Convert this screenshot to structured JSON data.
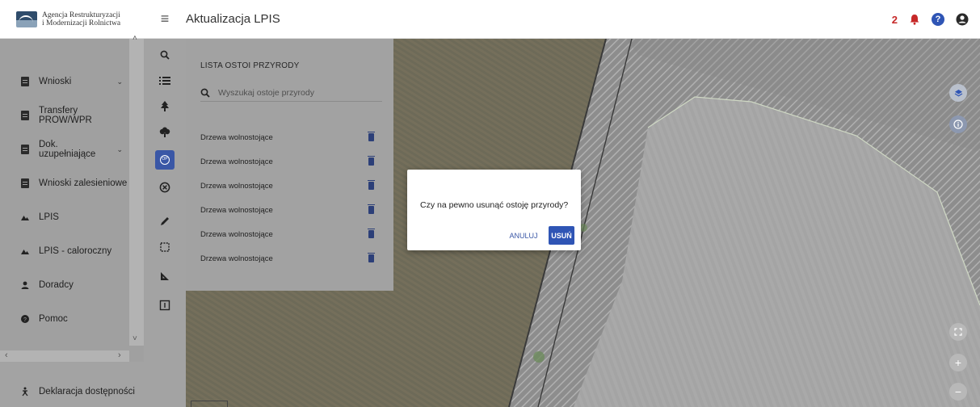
{
  "header": {
    "brand_line1": "Agencja Restrukturyzacji",
    "brand_line2": "i Modernizacji Rolnictwa",
    "menu_icon": "hamburger-icon",
    "title": "Aktualizacja LPIS",
    "notification_count": "2",
    "icons": [
      "bell-icon",
      "help-icon",
      "account-icon"
    ]
  },
  "sidebar": {
    "items": [
      {
        "label": "Wnioski",
        "icon": "clipboard-icon",
        "expandable": true
      },
      {
        "label": "Transfery PROW/WPR",
        "icon": "clipboard-icon",
        "expandable": false
      },
      {
        "label": "Dok. uzupełniające",
        "icon": "clipboard-icon",
        "expandable": true
      },
      {
        "label": "Wnioski zalesieniowe",
        "icon": "clipboard-icon",
        "expandable": false
      },
      {
        "label": "LPIS",
        "icon": "mountains-icon",
        "expandable": false
      },
      {
        "label": "LPIS - caloroczny",
        "icon": "mountains-icon",
        "expandable": false
      },
      {
        "label": "Doradcy",
        "icon": "person-icon",
        "expandable": false
      },
      {
        "label": "Pomoc",
        "icon": "help-circle-icon",
        "expandable": false
      }
    ],
    "footer_item": {
      "label": "Deklaracja dostępności",
      "icon": "accessibility-icon"
    }
  },
  "tools": [
    "search-icon",
    "list-icon",
    "tree-icon",
    "shrub-icon",
    "ostoja-icon",
    "cancel-circle-icon",
    "pencil-icon",
    "select-area-icon",
    "measure-icon",
    "info-box-icon"
  ],
  "panel": {
    "title": "LISTA OSTOI PRZYRODY",
    "search_placeholder": "Wyszukaj ostoje przyrody",
    "rows": [
      "Drzewa wolnostojące",
      "Drzewa wolnostojące",
      "Drzewa wolnostojące",
      "Drzewa wolnostojące",
      "Drzewa wolnostojące",
      "Drzewa wolnostojące"
    ]
  },
  "dialog": {
    "message": "Czy na pewno usunąć ostoję przyrody?",
    "cancel_label": "ANULUJ",
    "delete_label": "USUŃ"
  },
  "map": {
    "controls": [
      "layers-icon",
      "info-icon",
      "fullscreen-icon",
      "zoom-in-icon",
      "zoom-out-icon"
    ],
    "zoom_in_label": "+",
    "zoom_out_label": "−"
  },
  "colors": {
    "accent": "#2f55b5",
    "sidebar_dimmed": "#a0a0a0",
    "parcel_fill": "#c9d3dc"
  }
}
